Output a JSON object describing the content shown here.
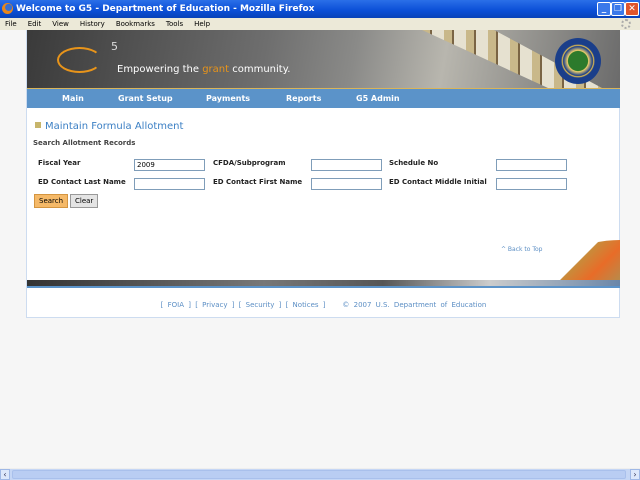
{
  "window": {
    "title": "Welcome to G5 - Department of Education - Mozilla Firefox"
  },
  "menu": [
    "File",
    "Edit",
    "View",
    "History",
    "Bookmarks",
    "Tools",
    "Help"
  ],
  "banner": {
    "logo": "G",
    "logo_sup": "5",
    "tagline_pre": "Empowering the ",
    "tagline_accent": "grant",
    "tagline_post": " community."
  },
  "nav": [
    "Main",
    "Grant Setup",
    "Payments",
    "Reports",
    "G5 Admin"
  ],
  "page": {
    "title": "Maintain Formula Allotment",
    "subtitle": "Search Allotment Records"
  },
  "form": {
    "fiscal_year_label": "Fiscal Year",
    "fiscal_year_value": "2009",
    "cfda_label": "CFDA/Subprogram",
    "cfda_value": "",
    "schedule_label": "Schedule No",
    "schedule_value": "",
    "last_label": "ED Contact Last Name",
    "last_value": "",
    "first_label": "ED Contact First Name",
    "first_value": "",
    "middle_label": "ED Contact Middle Initial",
    "middle_value": "",
    "search": "Search",
    "clear": "Clear"
  },
  "back_to_top": "^ Back to Top",
  "footer": {
    "links": [
      "FOIA",
      "Privacy",
      "Security",
      "Notices"
    ],
    "copyright": "© 2007 U.S. Department of Education"
  },
  "colors": {
    "nav": "#5b93c9",
    "accent": "#e8941a",
    "link": "#3b7fc4"
  }
}
